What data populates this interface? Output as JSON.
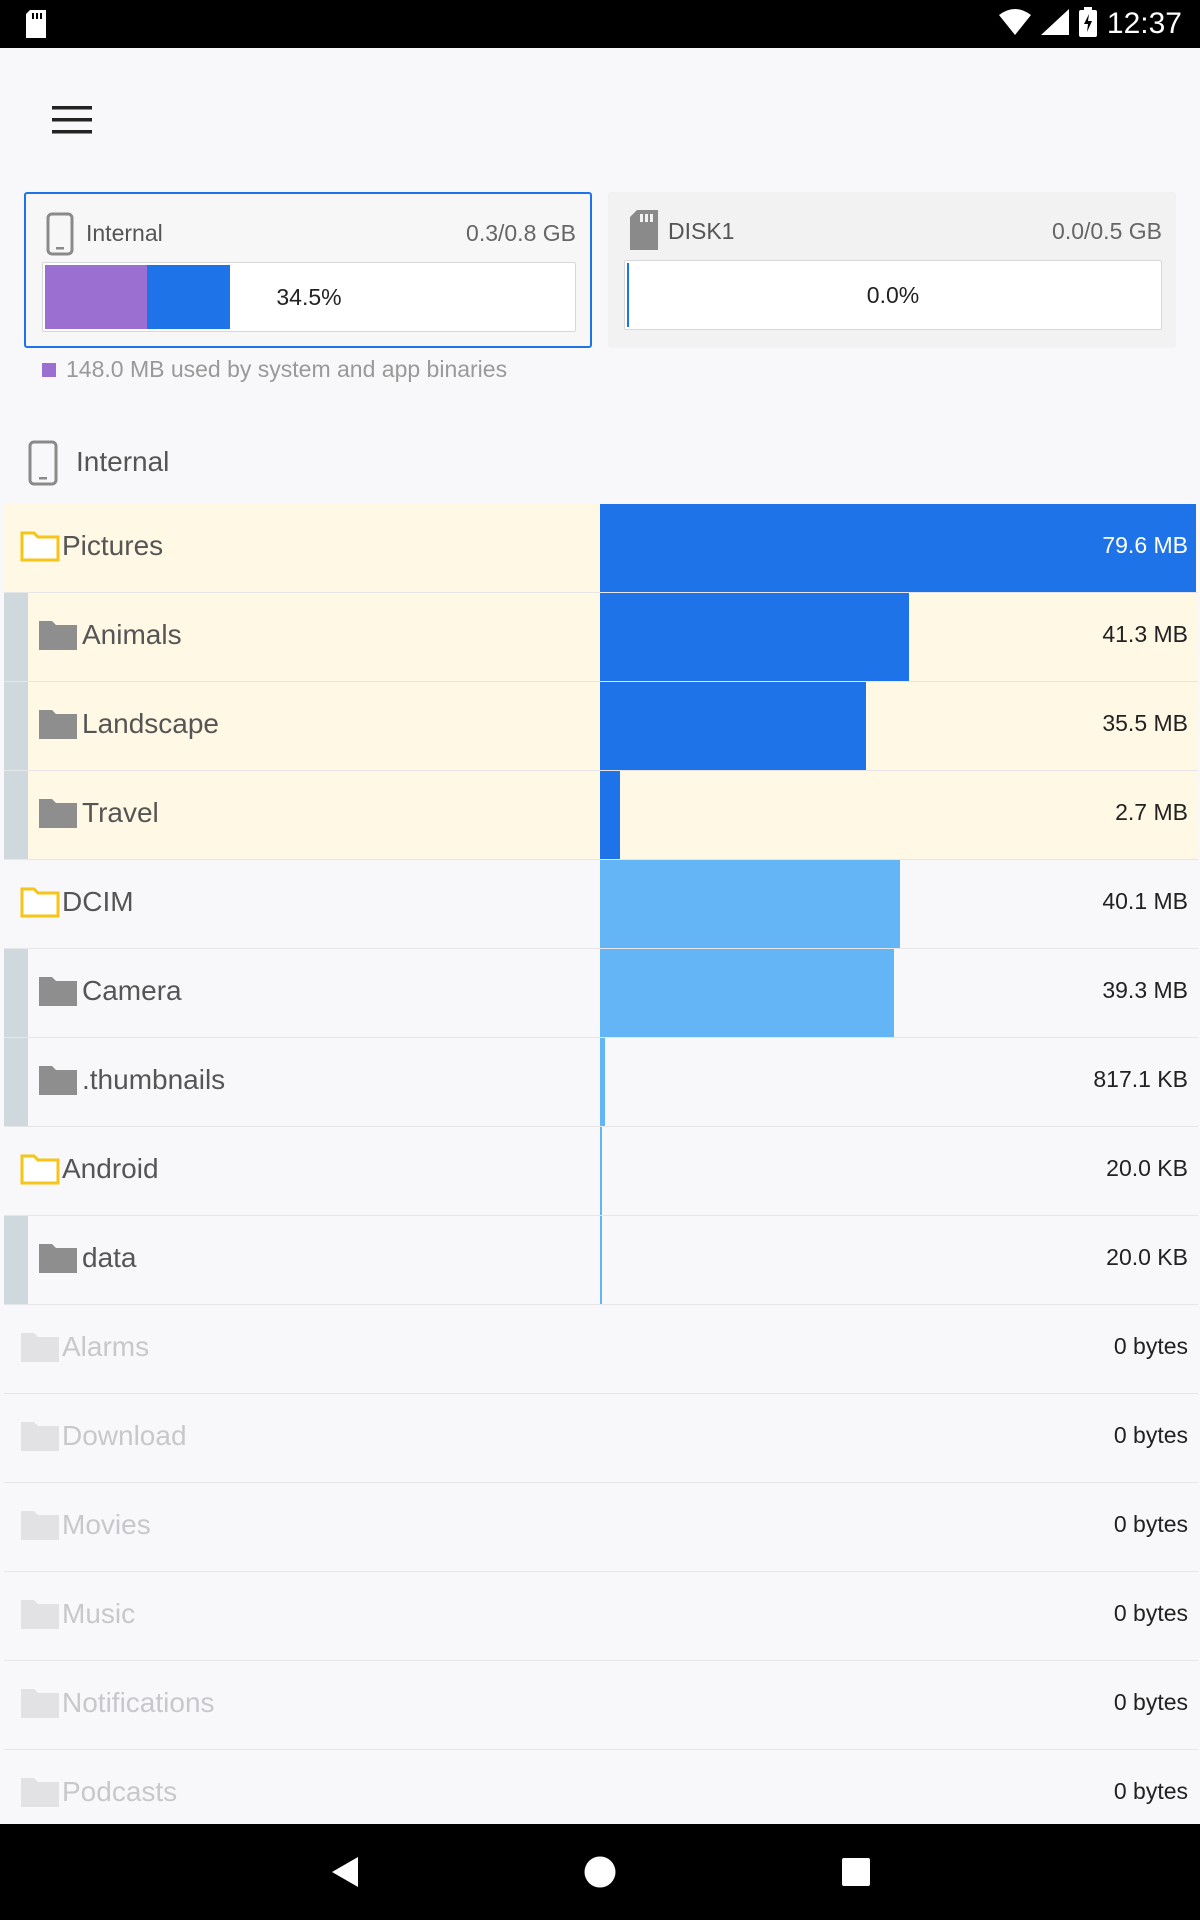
{
  "status_bar": {
    "time": "12:37"
  },
  "colors": {
    "accent": "#1e73e8",
    "system": "#9b6fd1",
    "light_blue": "#64b5f6",
    "highlight": "#fff8e4",
    "folder_yellow": "#f5c518"
  },
  "storage_cards": [
    {
      "name": "Internal",
      "usage": "0.3/0.8 GB",
      "percent_label": "34.5%",
      "system_fraction": 0.19,
      "used_fraction": 0.345,
      "selected": true,
      "icon": "phone-icon"
    },
    {
      "name": "DISK1",
      "usage": "0.0/0.5 GB",
      "percent_label": "0.0%",
      "system_fraction": 0,
      "used_fraction": 0.0,
      "selected": false,
      "icon": "sd-card-icon"
    }
  ],
  "legend": {
    "text": "148.0 MB used by system and app binaries"
  },
  "section": {
    "label": "Internal",
    "icon": "phone-icon"
  },
  "folders": [
    {
      "name": "Pictures",
      "size": "79.6 MB",
      "fraction": 1.0,
      "level": 0,
      "highlight": true,
      "bar": "dark",
      "state": "expanded"
    },
    {
      "name": "Animals",
      "size": "41.3 MB",
      "fraction": 0.519,
      "level": 1,
      "highlight": true,
      "bar": "dark",
      "state": "child"
    },
    {
      "name": "Landscape",
      "size": "35.5 MB",
      "fraction": 0.446,
      "level": 1,
      "highlight": true,
      "bar": "dark",
      "state": "child"
    },
    {
      "name": "Travel",
      "size": "2.7 MB",
      "fraction": 0.034,
      "level": 1,
      "highlight": true,
      "bar": "dark",
      "state": "child"
    },
    {
      "name": "DCIM",
      "size": "40.1 MB",
      "fraction": 0.504,
      "level": 0,
      "highlight": false,
      "bar": "light",
      "state": "expanded"
    },
    {
      "name": "Camera",
      "size": "39.3 MB",
      "fraction": 0.494,
      "level": 1,
      "highlight": false,
      "bar": "light",
      "state": "child"
    },
    {
      "name": ".thumbnails",
      "size": "817.1 KB",
      "fraction": 0.008,
      "level": 1,
      "highlight": false,
      "bar": "light",
      "state": "child"
    },
    {
      "name": "Android",
      "size": "20.0 KB",
      "fraction": 0.0003,
      "level": 0,
      "highlight": false,
      "bar": "light",
      "state": "expanded"
    },
    {
      "name": "data",
      "size": "20.0 KB",
      "fraction": 0.0003,
      "level": 1,
      "highlight": false,
      "bar": "light",
      "state": "child"
    },
    {
      "name": "Alarms",
      "size": "0 bytes",
      "fraction": 0,
      "level": 0,
      "highlight": false,
      "bar": "none",
      "state": "empty"
    },
    {
      "name": "Download",
      "size": "0 bytes",
      "fraction": 0,
      "level": 0,
      "highlight": false,
      "bar": "none",
      "state": "empty"
    },
    {
      "name": "Movies",
      "size": "0 bytes",
      "fraction": 0,
      "level": 0,
      "highlight": false,
      "bar": "none",
      "state": "empty"
    },
    {
      "name": "Music",
      "size": "0 bytes",
      "fraction": 0,
      "level": 0,
      "highlight": false,
      "bar": "none",
      "state": "empty"
    },
    {
      "name": "Notifications",
      "size": "0 bytes",
      "fraction": 0,
      "level": 0,
      "highlight": false,
      "bar": "none",
      "state": "empty"
    },
    {
      "name": "Podcasts",
      "size": "0 bytes",
      "fraction": 0,
      "level": 0,
      "highlight": false,
      "bar": "none",
      "state": "empty"
    }
  ]
}
